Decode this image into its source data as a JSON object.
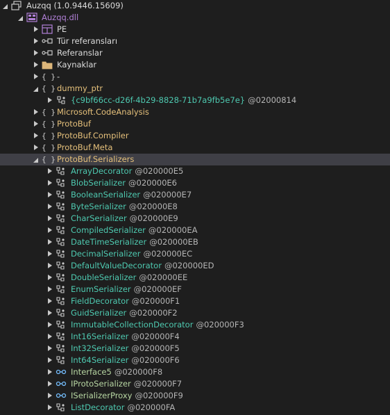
{
  "assembly": {
    "label": "Auzqq (1.0.9446.15609)"
  },
  "module": {
    "label": "Auzqq.dll"
  },
  "module_children": [
    {
      "label": "PE",
      "icon": "pe-icon"
    },
    {
      "label": "Tür referansları",
      "icon": "type-references-icon"
    },
    {
      "label": "Referanslar",
      "icon": "references-icon"
    },
    {
      "label": "Kaynaklar",
      "icon": "folder-icon"
    },
    {
      "label": "-",
      "icon": "namespace-icon"
    }
  ],
  "dummy_ptr": {
    "label": "dummy_ptr",
    "child": {
      "label": "{c9bf66cc-d26f-4b29-8828-71b7a9fb5e7e}",
      "token": "@02000814"
    }
  },
  "namespaces": [
    {
      "label": "Microsoft.CodeAnalysis"
    },
    {
      "label": "ProtoBuf"
    },
    {
      "label": "ProtoBuf.Compiler"
    },
    {
      "label": "ProtoBuf.Meta"
    }
  ],
  "selected_namespace": {
    "label": "ProtoBuf.Serializers"
  },
  "types": [
    {
      "name": "ArrayDecorator",
      "token": "@020000E5",
      "kind": "class"
    },
    {
      "name": "BlobSerializer",
      "token": "@020000E6",
      "kind": "class"
    },
    {
      "name": "BooleanSerializer",
      "token": "@020000E7",
      "kind": "class"
    },
    {
      "name": "ByteSerializer",
      "token": "@020000E8",
      "kind": "class"
    },
    {
      "name": "CharSerializer",
      "token": "@020000E9",
      "kind": "class"
    },
    {
      "name": "CompiledSerializer",
      "token": "@020000EA",
      "kind": "class"
    },
    {
      "name": "DateTimeSerializer",
      "token": "@020000EB",
      "kind": "class"
    },
    {
      "name": "DecimalSerializer",
      "token": "@020000EC",
      "kind": "class"
    },
    {
      "name": "DefaultValueDecorator",
      "token": "@020000ED",
      "kind": "class"
    },
    {
      "name": "DoubleSerializer",
      "token": "@020000EE",
      "kind": "class"
    },
    {
      "name": "EnumSerializer",
      "token": "@020000EF",
      "kind": "class"
    },
    {
      "name": "FieldDecorator",
      "token": "@020000F1",
      "kind": "class"
    },
    {
      "name": "GuidSerializer",
      "token": "@020000F2",
      "kind": "class"
    },
    {
      "name": "ImmutableCollectionDecorator",
      "token": "@020000F3",
      "kind": "class"
    },
    {
      "name": "Int16Serializer",
      "token": "@020000F4",
      "kind": "class"
    },
    {
      "name": "Int32Serializer",
      "token": "@020000F5",
      "kind": "class"
    },
    {
      "name": "Int64Serializer",
      "token": "@020000F6",
      "kind": "class"
    },
    {
      "name": "Interface5",
      "token": "@020000F8",
      "kind": "interface"
    },
    {
      "name": "IProtoSerializer",
      "token": "@020000F7",
      "kind": "interface"
    },
    {
      "name": "ISerializerProxy",
      "token": "@020000F9",
      "kind": "interface"
    },
    {
      "name": "ListDecorator",
      "token": "@020000FA",
      "kind": "class"
    }
  ],
  "colors": {
    "background": "#1e1e1e",
    "selection": "#3f3f46",
    "namespace": "#e5c07b",
    "type": "#4ec9b0",
    "interface": "#b8d7a3",
    "module": "#b180d7"
  }
}
